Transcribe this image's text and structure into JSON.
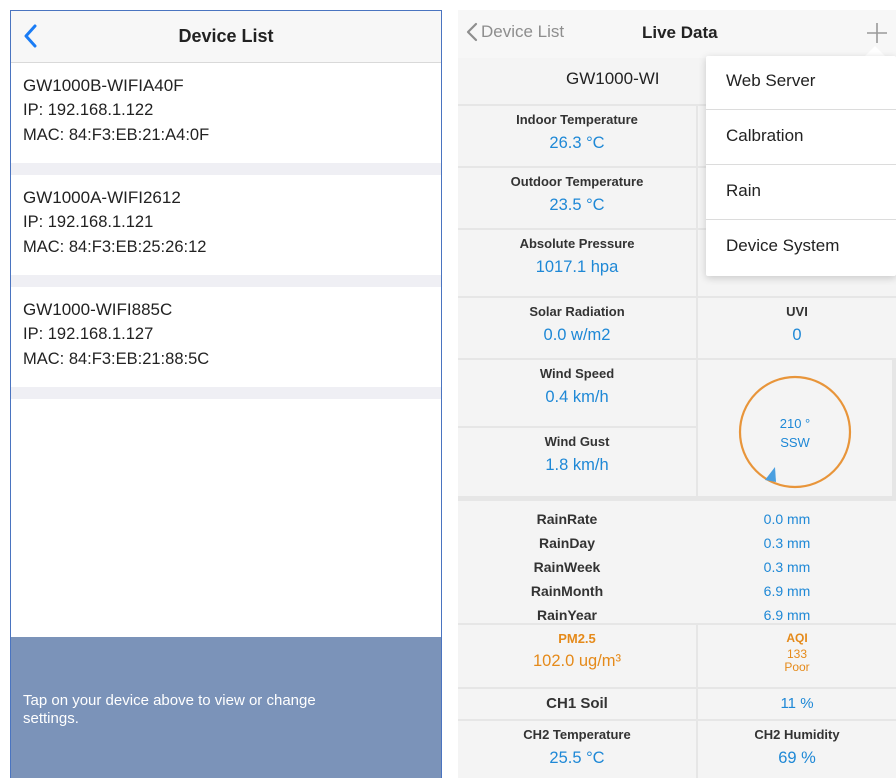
{
  "device_list_screen": {
    "title": "Device List",
    "devices": [
      {
        "name": "GW1000B-WIFIA40F",
        "ip": "IP: 192.168.1.122",
        "mac": "MAC: 84:F3:EB:21:A4:0F"
      },
      {
        "name": "GW1000A-WIFI2612",
        "ip": "IP: 192.168.1.121",
        "mac": "MAC: 84:F3:EB:25:26:12"
      },
      {
        "name": "GW1000-WIFI885C",
        "ip": "IP: 192.168.1.127",
        "mac": "MAC: 84:F3:EB:21:88:5C"
      }
    ],
    "footer_hint": "Tap on your device above to view or change settings."
  },
  "live_data_screen": {
    "back_label": "Device List",
    "title": "Live Data",
    "device_name": "GW1000-WI",
    "indoor_temperature": {
      "label": "Indoor Temperature",
      "value": "26.3 °C"
    },
    "outdoor_temperature": {
      "label": "Outdoor Temperature",
      "value": "23.5 °C"
    },
    "absolute_pressure": {
      "label": "Absolute Pressure",
      "value": "1017.1 hpa"
    },
    "solar_radiation": {
      "label": "Solar Radiation",
      "value": "0.0 w/m2"
    },
    "uvi": {
      "label": "UVI",
      "value": "0"
    },
    "wind_speed": {
      "label": "Wind Speed",
      "value": "0.4 km/h"
    },
    "wind_gust": {
      "label": "Wind Gust",
      "value": "1.8 km/h"
    },
    "wind_direction": {
      "degrees": "210 °",
      "cardinal": "SSW"
    },
    "rain": [
      {
        "label": "RainRate",
        "value": "0.0 mm"
      },
      {
        "label": "RainDay",
        "value": "0.3 mm"
      },
      {
        "label": "RainWeek",
        "value": "0.3 mm"
      },
      {
        "label": "RainMonth",
        "value": "6.9 mm"
      },
      {
        "label": "RainYear",
        "value": "6.9 mm"
      }
    ],
    "pm25": {
      "label": "PM2.5",
      "value": "102.0 ug/m³"
    },
    "aqi": {
      "label": "AQI",
      "value": "133",
      "level": "Poor"
    },
    "ch1_soil": {
      "label": "CH1 Soil",
      "value": "11 %"
    },
    "ch2_temperature": {
      "label": "CH2 Temperature",
      "value": "25.5 °C"
    },
    "ch2_humidity": {
      "label": "CH2 Humidity",
      "value": "69 %"
    },
    "menu": [
      "Web Server",
      "Calbration",
      "Rain",
      "Device System"
    ]
  },
  "colors": {
    "accent_blue": "#1e88d6",
    "accent_orange": "#e58a1a",
    "ios_blue": "#1a7cf5",
    "footer_bg": "#7b93b9"
  },
  "icons": [
    "back-chevron-icon",
    "plus-icon",
    "wind-compass-icon"
  ]
}
